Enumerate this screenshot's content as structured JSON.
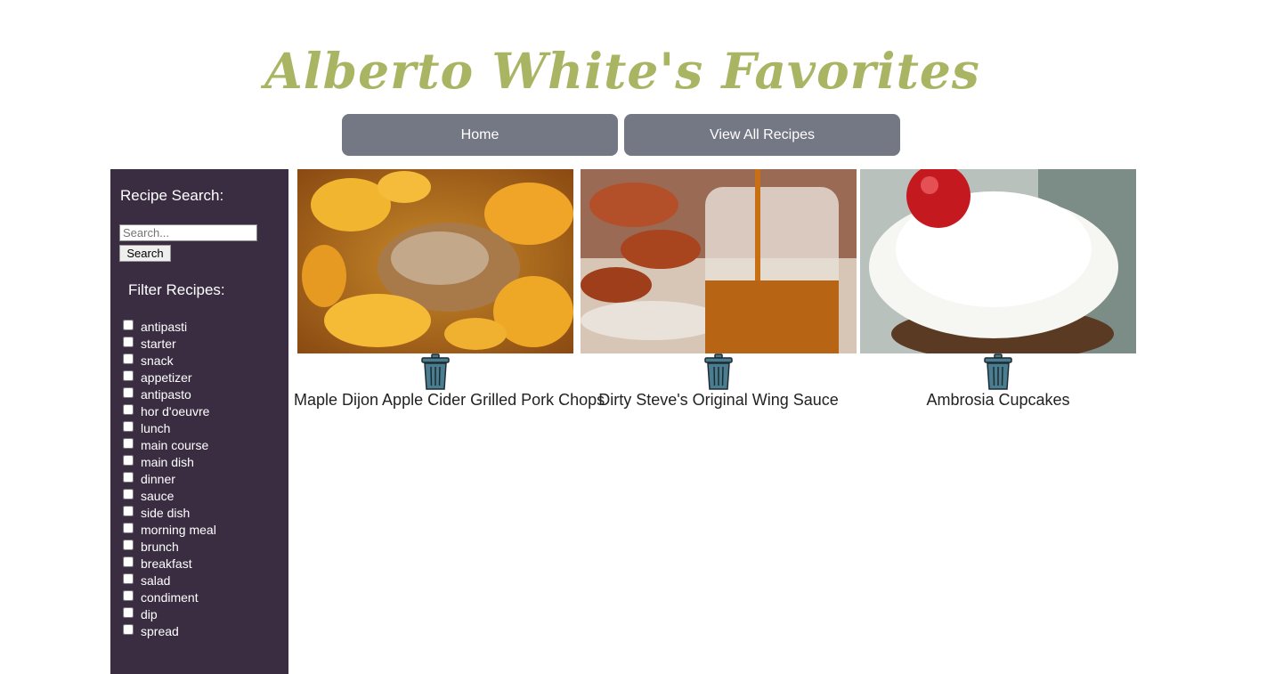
{
  "site": {
    "title": "Alberto White's Favorites",
    "title_color": "#aab564"
  },
  "nav": {
    "home_label": "Home",
    "all_recipes_label": "View All Recipes",
    "button_color": "#747784"
  },
  "sidebar": {
    "background": "#3a2d42",
    "search_heading": "Recipe Search:",
    "search_placeholder": "Search...",
    "search_button_label": "Search",
    "filter_heading": "Filter Recipes:",
    "filters": [
      "antipasti",
      "starter",
      "snack",
      "appetizer",
      "antipasto",
      "hor d'oeuvre",
      "lunch",
      "main course",
      "main dish",
      "dinner",
      "sauce",
      "side dish",
      "morning meal",
      "brunch",
      "breakfast",
      "salad",
      "condiment",
      "dip",
      "spread"
    ]
  },
  "recipes": [
    {
      "title": "Maple Dijon Apple Cider Grilled Pork Chops",
      "image": "pork-chops-photo",
      "icon": "trash-icon"
    },
    {
      "title": "Dirty Steve's Original Wing Sauce",
      "image": "wing-sauce-photo",
      "icon": "trash-icon"
    },
    {
      "title": "Ambrosia Cupcakes",
      "image": "cupcake-photo",
      "icon": "trash-icon"
    }
  ]
}
